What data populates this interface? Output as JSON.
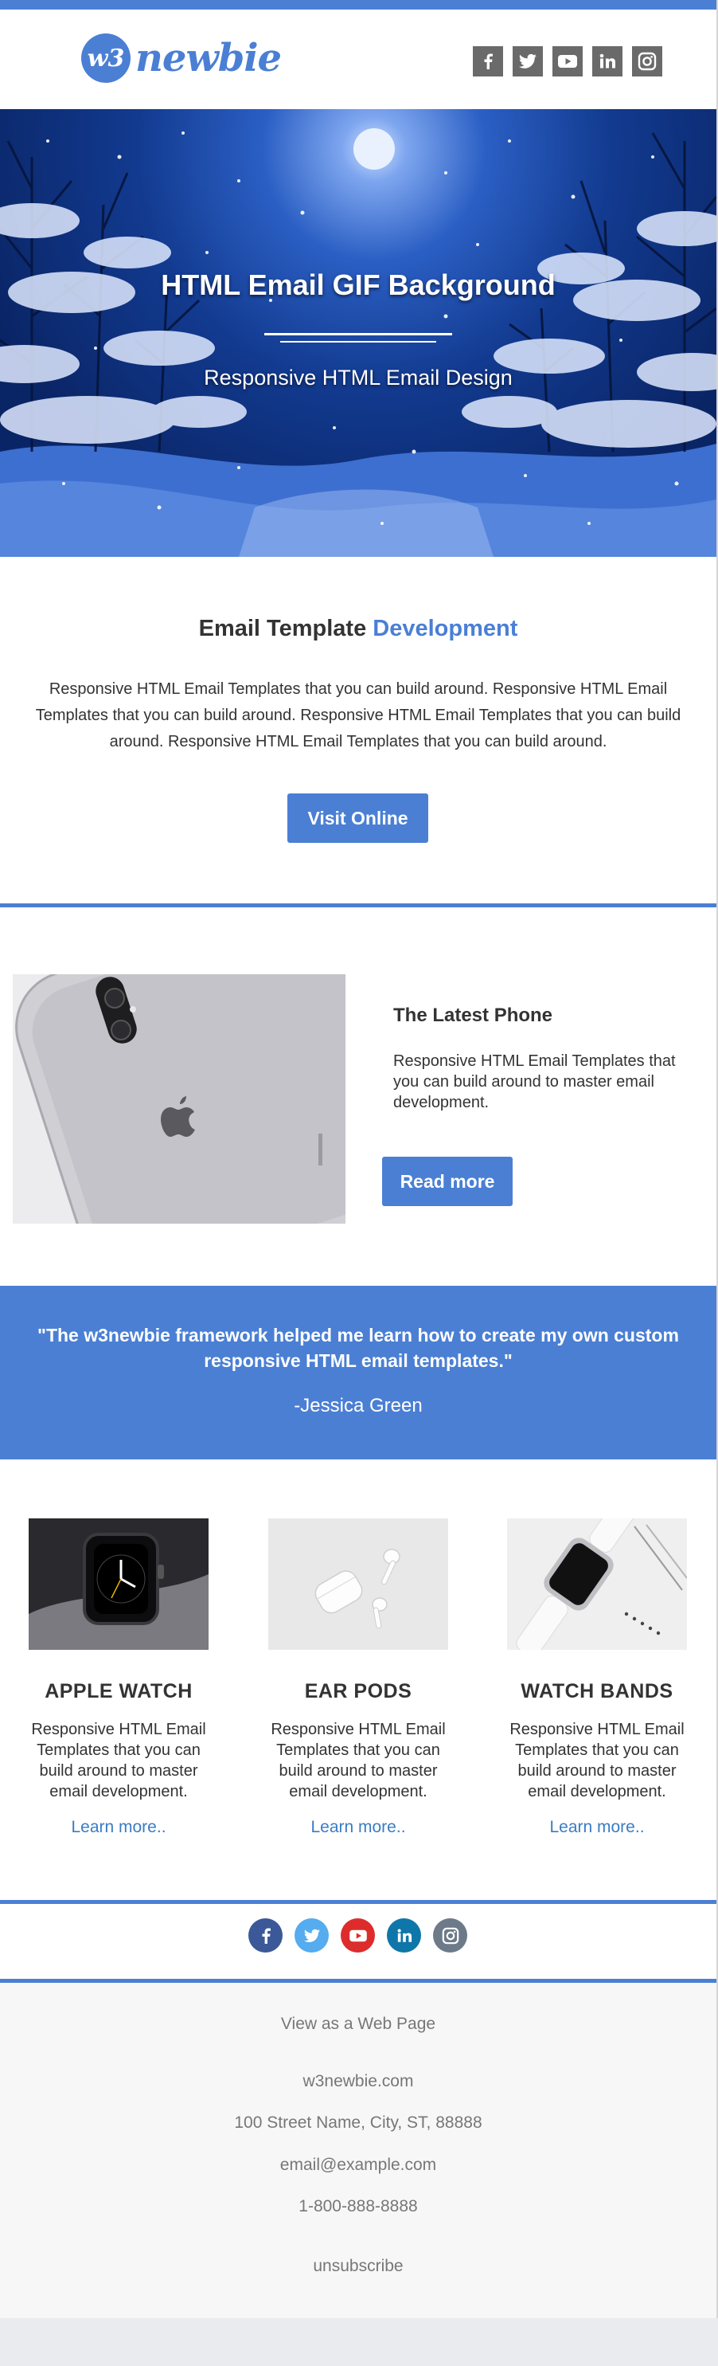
{
  "colors": {
    "accent": "#4a7fd4",
    "link": "#3a7cc4",
    "icon_gray": "#6a6a6a",
    "facebook": "#3b5998",
    "twitter": "#55acee",
    "youtube": "#dd2c2c",
    "linkedin": "#0e76a8",
    "instagram": "#6c7a89"
  },
  "header": {
    "logo_mark": "w3",
    "logo_text": "newbie",
    "social": [
      "facebook-icon",
      "twitter-icon",
      "youtube-icon",
      "linkedin-icon",
      "instagram-icon"
    ]
  },
  "hero": {
    "title": "HTML Email GIF Background",
    "subtitle": "Responsive HTML Email Design"
  },
  "intro": {
    "title_plain": "Email Template ",
    "title_accent": "Development",
    "body": "Responsive HTML Email Templates that you can build around. Responsive HTML Email Templates that you can build around. Responsive HTML Email Templates that you can build around. Responsive HTML Email Templates that you can build around.",
    "button": "Visit Online"
  },
  "feature": {
    "title": "The Latest Phone",
    "body": "Responsive HTML Email Templates that you can build around to master email development.",
    "button": "Read more"
  },
  "testimonial": {
    "quote": "\"The w3newbie framework helped me learn how to create my own custom responsive HTML email templates.\"",
    "author": "-Jessica Green"
  },
  "products": [
    {
      "title": "APPLE WATCH",
      "body": "Responsive HTML Email Templates that you can build around to master email development.",
      "link": "Learn more.."
    },
    {
      "title": "EAR PODS",
      "body": "Responsive HTML Email Templates that you can build around to master email development.",
      "link": "Learn more.."
    },
    {
      "title": "WATCH BANDS",
      "body": "Responsive HTML Email Templates that you can build around to master email development.",
      "link": "Learn more.."
    }
  ],
  "footer": {
    "web_page": "View as a Web Page",
    "site": "w3newbie.com",
    "address": "100 Street Name, City, ST, 88888",
    "email": "email@example.com",
    "phone": "1-800-888-8888",
    "unsubscribe": "unsubscribe"
  }
}
